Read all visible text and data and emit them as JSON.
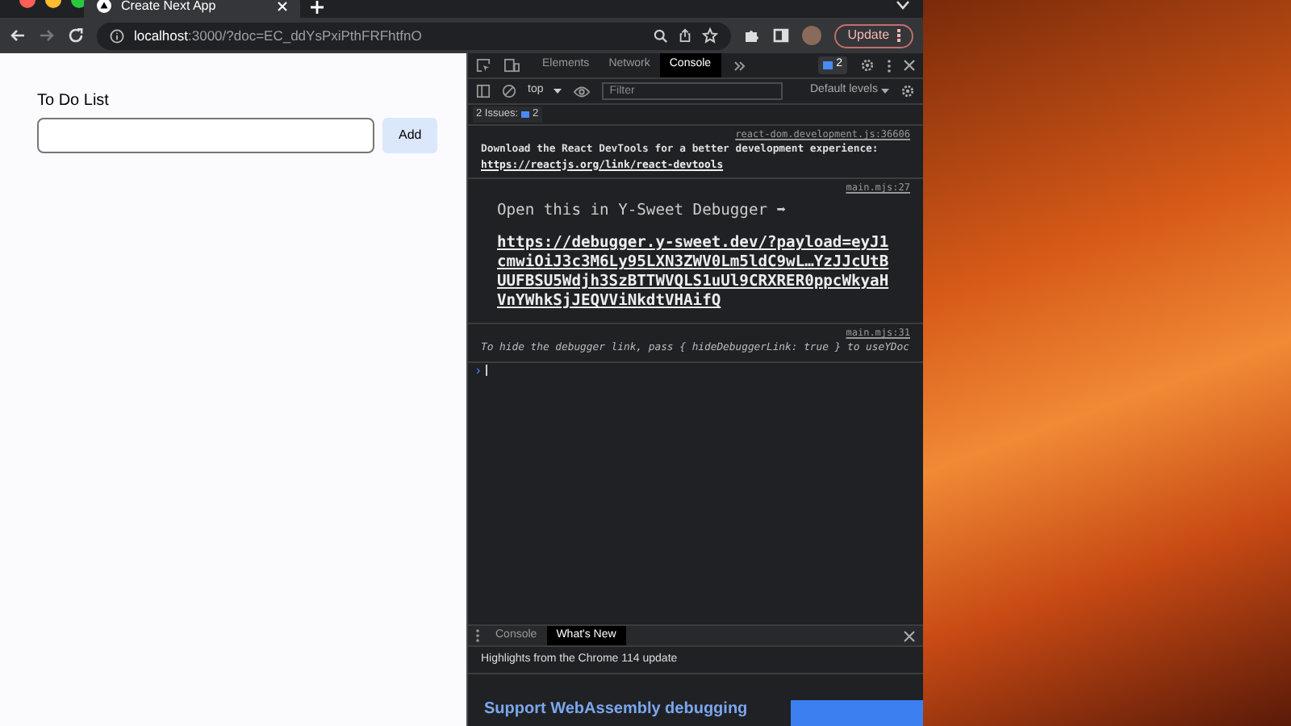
{
  "browser": {
    "tab": {
      "title": "Create Next App"
    },
    "address": {
      "host": "localhost",
      "path": ":3000/?doc=EC_ddYsPxiPthFRFhtfnO"
    },
    "update_button": "Update"
  },
  "page": {
    "heading": "To Do List",
    "add_button": "Add"
  },
  "devtools": {
    "tabs": [
      {
        "label": "Elements",
        "selected": false
      },
      {
        "label": "Network",
        "selected": false
      },
      {
        "label": "Console",
        "selected": true
      }
    ],
    "issue_badge": "2",
    "context": "top",
    "filter": {
      "placeholder": "Filter"
    },
    "levels": "Default levels",
    "issues": {
      "label": "2 Issues:",
      "count": "2"
    },
    "messages": [
      {
        "kind": "small",
        "source": "react-dom.development.js:36606",
        "text": "Download the React DevTools for a better development experience: ",
        "link": "https://reactjs.org/link/react-devtools"
      },
      {
        "kind": "large",
        "source": "main.mjs:27",
        "text": "Open this in Y-Sweet Debugger ➡ ",
        "link": "https://debugger.y-sweet.dev/?payload=eyJ1cmwiOiJ3c3M6Ly95LXN3ZWV0Lm5ldC9wL…YzJJcUtBUUFBSU5Wdjh3SzBTTWVQLS1uUl9CRXRER0ppcWkyaHVnYWhkSjJEQVViNkdtVHAifQ"
      },
      {
        "kind": "italic",
        "source": "main.mjs:31",
        "text": "To hide the debugger link, pass { hideDebuggerLink: true } to useYDoc"
      }
    ],
    "prompt": "›",
    "drawer": {
      "tabs": [
        {
          "label": "Console",
          "selected": false
        },
        {
          "label": "What's New",
          "selected": true
        }
      ],
      "highlights": "Highlights from the Chrome 114 update",
      "feature": "Support WebAssembly debugging"
    }
  }
}
